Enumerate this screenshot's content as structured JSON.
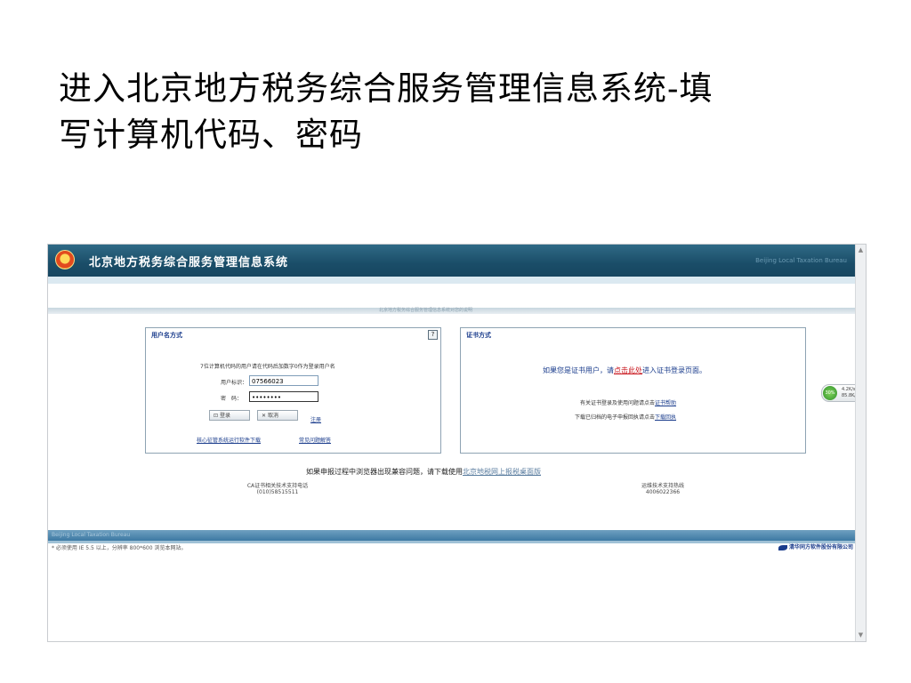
{
  "slide": {
    "title_line1": "进入北京地方税务综合服务管理信息系统-填",
    "title_line2": "写计算机代码、密码"
  },
  "app": {
    "title": "北京地方税务综合服务管理信息系统",
    "top_right_text": "Beijing Local Taxation Bureau",
    "subbar_text": "北京地方税务综合服务管理信息系统对您的说明",
    "username_panel": {
      "title": "用户名方式",
      "help": "?",
      "hint": "7位计算机代码的用户请在代码后加数字0作为登录用户名",
      "user_label": "用户标识：",
      "user_value": "07566023",
      "pwd_label": "密　码：",
      "pwd_value": "••••••••",
      "login_btn": "登录",
      "cancel_btn": "取消",
      "register_link": "注册",
      "download_link": "核心征管系统运行软件下载",
      "faq_link": "常见问题解答"
    },
    "cert_panel": {
      "title": "证书方式",
      "line1_pre": "如果您是证书用户，请",
      "line1_link": "点击此处",
      "line1_post": "进入证书登录页面。",
      "line2_pre": "有关证书登录及使用问题请点击",
      "line2_link": "证书帮助",
      "line3_pre": "下载已归档的电子申报回执请点击",
      "line3_link": "下载回执"
    },
    "browser_notice_pre": "如果申报过程中浏览器出现兼容问题，请下载使用",
    "browser_notice_link": "北京地税网上报税桌面版",
    "ca_support_label": "CA证书相关技术支持电话",
    "ca_support_phone": "(010)58515511",
    "maint_support_label": "运维技术支持热线",
    "maint_support_phone": "4006022366",
    "band_text": "Beijing Local Taxation Bureau",
    "footer_note": "* 必须使用 IE 5.5 以上，分辨率 800*600 浏览本网站。",
    "company": "清华同方软件股份有限公司",
    "speed": {
      "dial": "30%",
      "up": "4.2K/s",
      "down": "85.8K/s"
    }
  }
}
